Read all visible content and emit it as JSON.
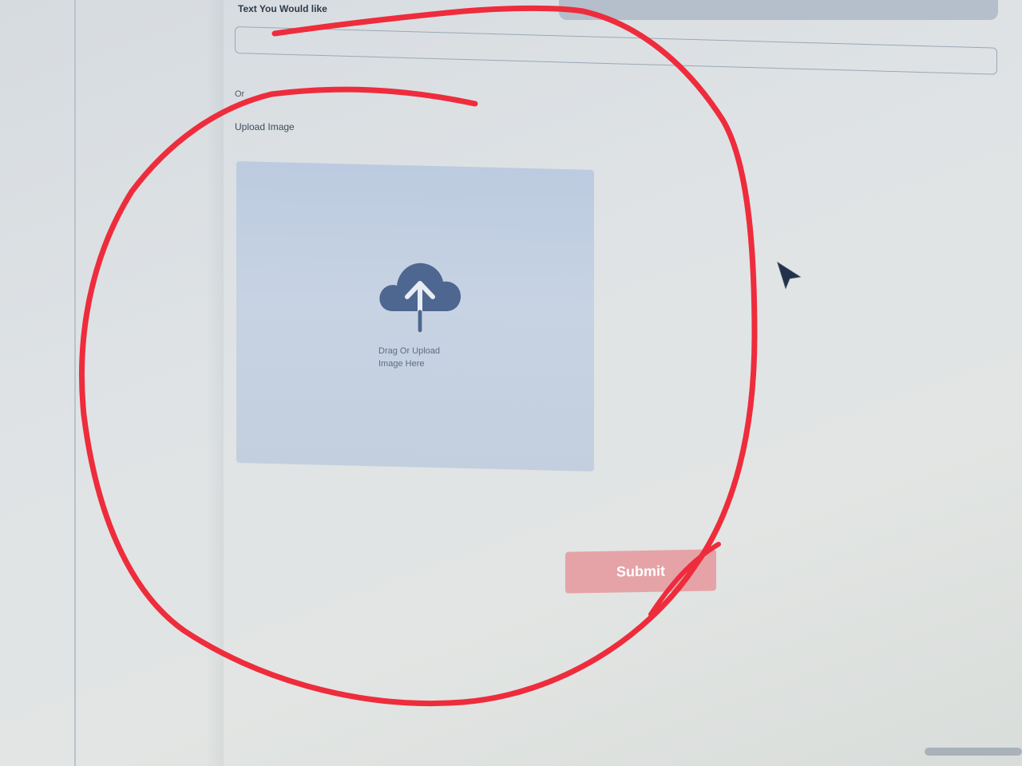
{
  "form": {
    "text_field_label": "Text You Would like",
    "text_field_value": "",
    "or_label": "Or",
    "upload_label": "Upload Image",
    "dropzone_text_line1": "Drag Or Upload",
    "dropzone_text_line2": "Image Here",
    "submit_label": "Submit"
  },
  "icons": {
    "upload": "cloud-upload-icon",
    "pointer": "mouse-pointer-icon"
  },
  "colors": {
    "dropzone_bg": "#c4d0e1",
    "cloud_icon": "#4d6790",
    "submit_bg": "#e5a3a8",
    "annotation_red": "#ee2c3c"
  }
}
